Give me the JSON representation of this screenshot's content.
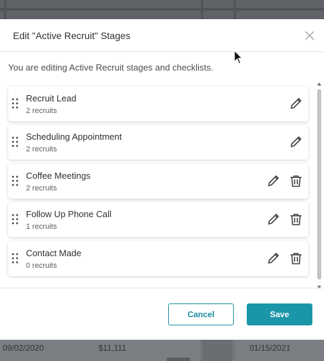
{
  "modal": {
    "title": "Edit \"Active Recruit\" Stages",
    "intro": "You are editing Active Recruit stages and checklists.",
    "close_icon": "close-icon"
  },
  "stages": [
    {
      "name": "Recruit Lead",
      "count": "2 recruits",
      "deletable": false
    },
    {
      "name": "Scheduling Appointment",
      "count": "2 recruits",
      "deletable": false
    },
    {
      "name": "Coffee Meetings",
      "count": "2 recruits",
      "deletable": true
    },
    {
      "name": "Follow Up Phone Call",
      "count": "1 recruits",
      "deletable": true
    },
    {
      "name": "Contact Made",
      "count": "0 recruits",
      "deletable": true
    }
  ],
  "footer": {
    "cancel_label": "Cancel",
    "save_label": "Save"
  },
  "background": {
    "date_left": "09/02/2020",
    "amount": "$11,111",
    "date_right": "01/15/2021"
  },
  "colors": {
    "accent": "#1b96a8",
    "overlay": "#6f7378"
  }
}
